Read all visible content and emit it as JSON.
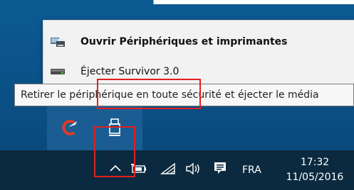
{
  "context_menu": {
    "items": [
      {
        "label": "Ouvrir Périphériques et imprimantes",
        "icon": "devices-printers-icon"
      },
      {
        "label": "Éjecter Survivor 3.0",
        "icon": "drive-icon"
      }
    ]
  },
  "tooltip": {
    "text": "Retirer le périphérique en toute sécurité et éjecter le média"
  },
  "tray_popup": {
    "icons": [
      "ccleaner-icon",
      "usb-eject-icon"
    ]
  },
  "taskbar": {
    "language": "FRA",
    "time": "17:32",
    "date": "11/05/2016"
  },
  "colors": {
    "highlight": "#e21f1f",
    "taskbar": "#0b2a3f",
    "tray_popup": "#1b5d92"
  }
}
